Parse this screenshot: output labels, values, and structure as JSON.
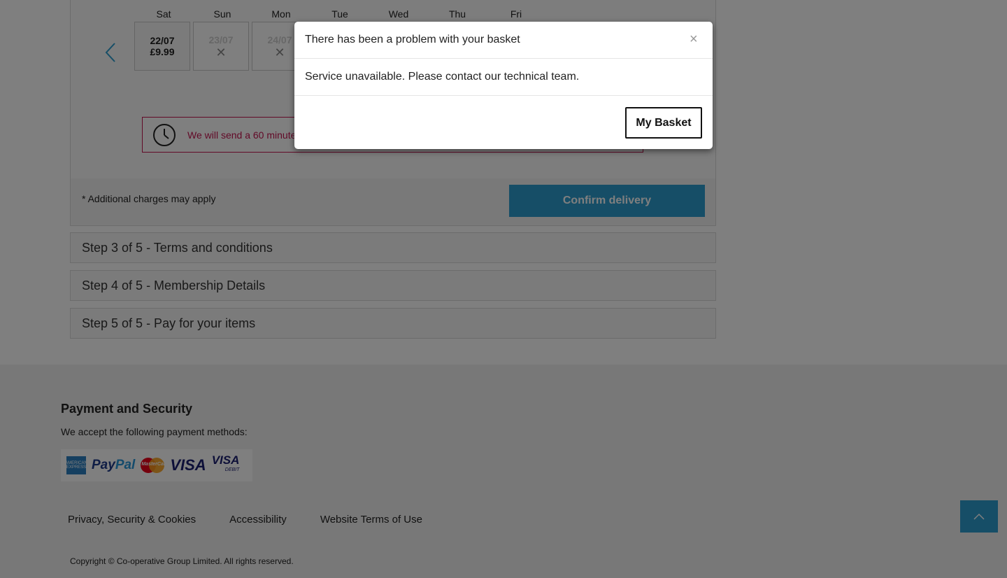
{
  "delivery": {
    "days": [
      "Sat",
      "Sun",
      "Mon",
      "Tue",
      "Wed",
      "Thu",
      "Fri"
    ],
    "slots": [
      {
        "date": "22/07",
        "price": "£9.99",
        "status": "selected"
      },
      {
        "date": "23/07",
        "price": "",
        "status": "unavailable"
      },
      {
        "date": "24/07",
        "price": "",
        "status": "unavailable"
      }
    ],
    "slot_cross": "✕",
    "notice": "We will send a 60 minute",
    "charges": "* Additional charges may apply",
    "confirm_label": "Confirm delivery"
  },
  "steps": [
    {
      "label": "Step 3 of 5 - Terms and conditions"
    },
    {
      "label": "Step 4 of 5 - Membership Details"
    },
    {
      "label": "Step 5 of 5 - Pay for your items"
    }
  ],
  "footer": {
    "title": "Payment and Security",
    "subtitle": "We accept the following payment methods:",
    "payment_methods": {
      "amex": "AMERICAN EXPRESS",
      "paypal_a": "Pay",
      "paypal_b": "Pal",
      "mastercard": "MasterCard",
      "visa": "VISA",
      "visa_debit": "VISA",
      "visa_debit_sub": "DEBIT"
    },
    "links": [
      "Privacy, Security & Cookies",
      "Accessibility",
      "Website Terms of Use"
    ],
    "copyright": "Copyright © Co-operative Group Limited. All rights reserved."
  },
  "modal": {
    "title": "There has been a problem with your basket",
    "close": "×",
    "message": "Service unavailable. Please contact our technical team.",
    "button": "My Basket"
  },
  "colors": {
    "accent": "#2d9dce",
    "notice": "#c4134f",
    "overlay": "rgba(0,0,0,0.5)"
  }
}
